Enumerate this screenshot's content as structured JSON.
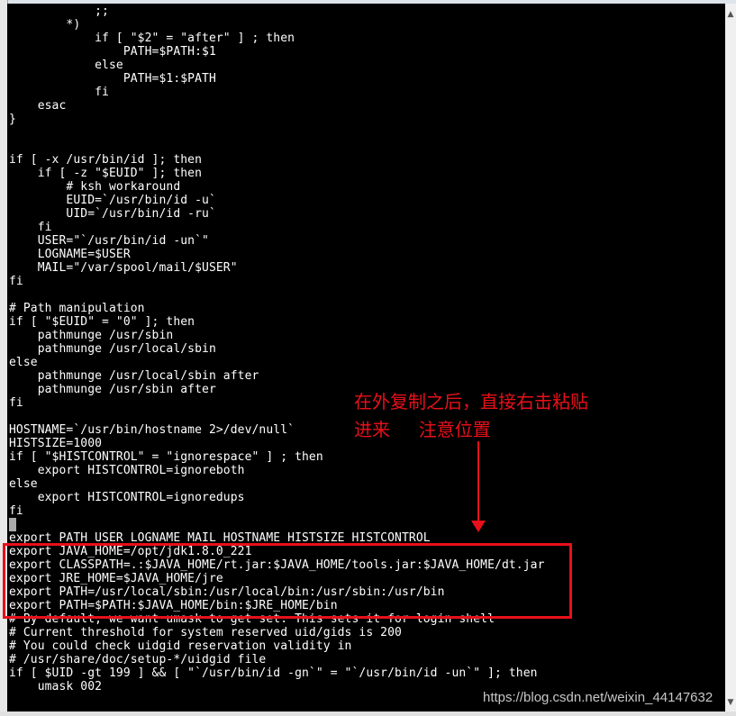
{
  "terminal": {
    "lines": [
      "            ;;",
      "        *)",
      "            if [ \"$2\" = \"after\" ] ; then",
      "                PATH=$PATH:$1",
      "            else",
      "                PATH=$1:$PATH",
      "            fi",
      "    esac",
      "}",
      "",
      "",
      "if [ -x /usr/bin/id ]; then",
      "    if [ -z \"$EUID\" ]; then",
      "        # ksh workaround",
      "        EUID=`/usr/bin/id -u`",
      "        UID=`/usr/bin/id -ru`",
      "    fi",
      "    USER=\"`/usr/bin/id -un`\"",
      "    LOGNAME=$USER",
      "    MAIL=\"/var/spool/mail/$USER\"",
      "fi",
      "",
      "# Path manipulation",
      "if [ \"$EUID\" = \"0\" ]; then",
      "    pathmunge /usr/sbin",
      "    pathmunge /usr/local/sbin",
      "else",
      "    pathmunge /usr/local/sbin after",
      "    pathmunge /usr/sbin after",
      "fi",
      "",
      "HOSTNAME=`/usr/bin/hostname 2>/dev/null`",
      "HISTSIZE=1000",
      "if [ \"$HISTCONTROL\" = \"ignorespace\" ] ; then",
      "    export HISTCONTROL=ignoreboth",
      "else",
      "    export HISTCONTROL=ignoredups",
      "fi",
      "",
      "export PATH USER LOGNAME MAIL HOSTNAME HISTSIZE HISTCONTROL",
      "export JAVA_HOME=/opt/jdk1.8.0_221",
      "export CLASSPATH=.:$JAVA_HOME/rt.jar:$JAVA_HOME/tools.jar:$JAVA_HOME/dt.jar",
      "export JRE_HOME=$JAVA_HOME/jre",
      "export PATH=/usr/local/sbin:/usr/local/bin:/usr/sbin:/usr/bin",
      "export PATH=$PATH:$JAVA_HOME/bin:$JRE_HOME/bin",
      "# By default, we want umask to get set. This sets it for login shell",
      "# Current threshold for system reserved uid/gids is 200",
      "# You could check uidgid reservation validity in",
      "# /usr/share/doc/setup-*/uidgid file",
      "if [ $UID -gt 199 ] && [ \"`/usr/bin/id -gn`\" = \"`/usr/bin/id -un`\" ]; then",
      "    umask 002"
    ]
  },
  "annotation": {
    "line1": "在外复制之后，直接右击粘贴",
    "line2": "进来     注意位置",
    "color": "#e8101a"
  },
  "watermark": "https://blog.csdn.net/weixin_44147632",
  "scrollbar": {
    "up_icon": "chevron-up-icon",
    "down_icon": "chevron-down-icon"
  }
}
